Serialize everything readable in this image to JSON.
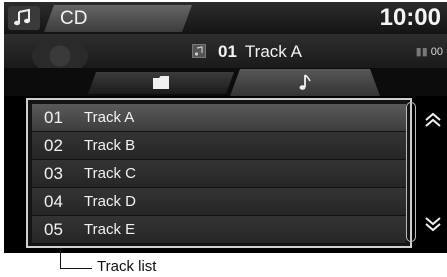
{
  "header": {
    "source_label": "CD",
    "clock": "10:00"
  },
  "now_playing": {
    "track_number": "01",
    "track_name": "Track A",
    "elapsed": "00"
  },
  "tabs": [
    {
      "icon": "folder-icon"
    },
    {
      "icon": "music-note-icon",
      "selected": true
    }
  ],
  "track_list": [
    {
      "number": "01",
      "name": "Track A",
      "selected": true
    },
    {
      "number": "02",
      "name": "Track B"
    },
    {
      "number": "03",
      "name": "Track C"
    },
    {
      "number": "04",
      "name": "Track D"
    },
    {
      "number": "05",
      "name": "Track E"
    }
  ],
  "callout": {
    "label": "Track list"
  },
  "colors": {
    "screen_bg": "#000000",
    "selected_row": "#4a4a4a",
    "row": "#2e2e2e",
    "text": "#f2f2f2"
  }
}
